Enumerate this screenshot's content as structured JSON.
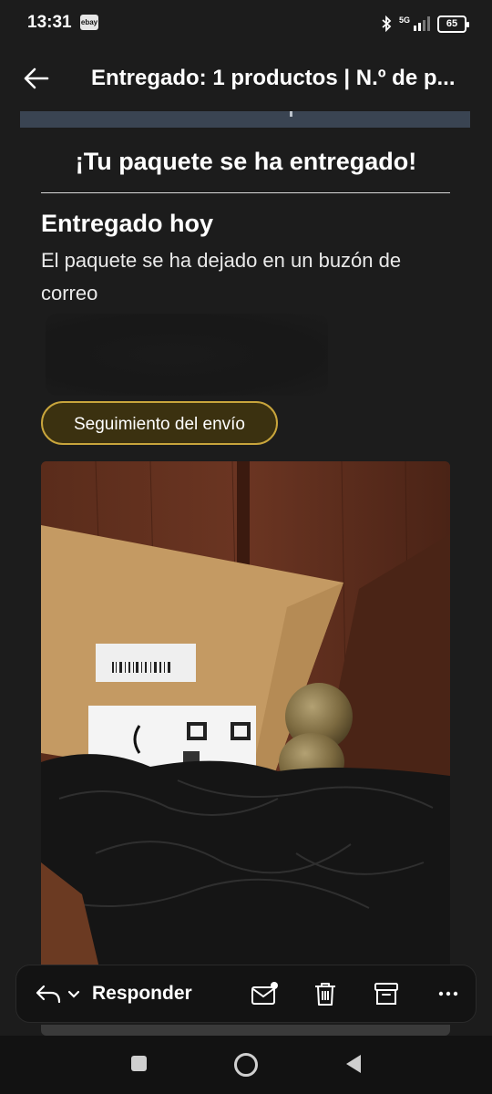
{
  "status_bar": {
    "time": "13:31",
    "notification_badge": "ebay",
    "network": "5G",
    "battery": "65"
  },
  "app_bar": {
    "title": "Entregado: 1 productos | N.º de p..."
  },
  "email": {
    "headline": "¡Tu paquete se ha entregado!",
    "status_title": "Entregado hoy",
    "status_description": "El paquete se ha dejado en un buzón de correo",
    "track_button": "Seguimiento del envío",
    "button_border_color": "#c8a53c",
    "button_fill_color": "#3b3110"
  },
  "action_bar": {
    "reply_label": "Responder",
    "icons": [
      "reply-icon",
      "chevron-down-icon",
      "mail-unread-icon",
      "trash-icon",
      "archive-icon",
      "more-icon"
    ]
  },
  "nav_bar": {
    "icons": [
      "recents-square-icon",
      "home-circle-icon",
      "back-triangle-icon"
    ]
  }
}
